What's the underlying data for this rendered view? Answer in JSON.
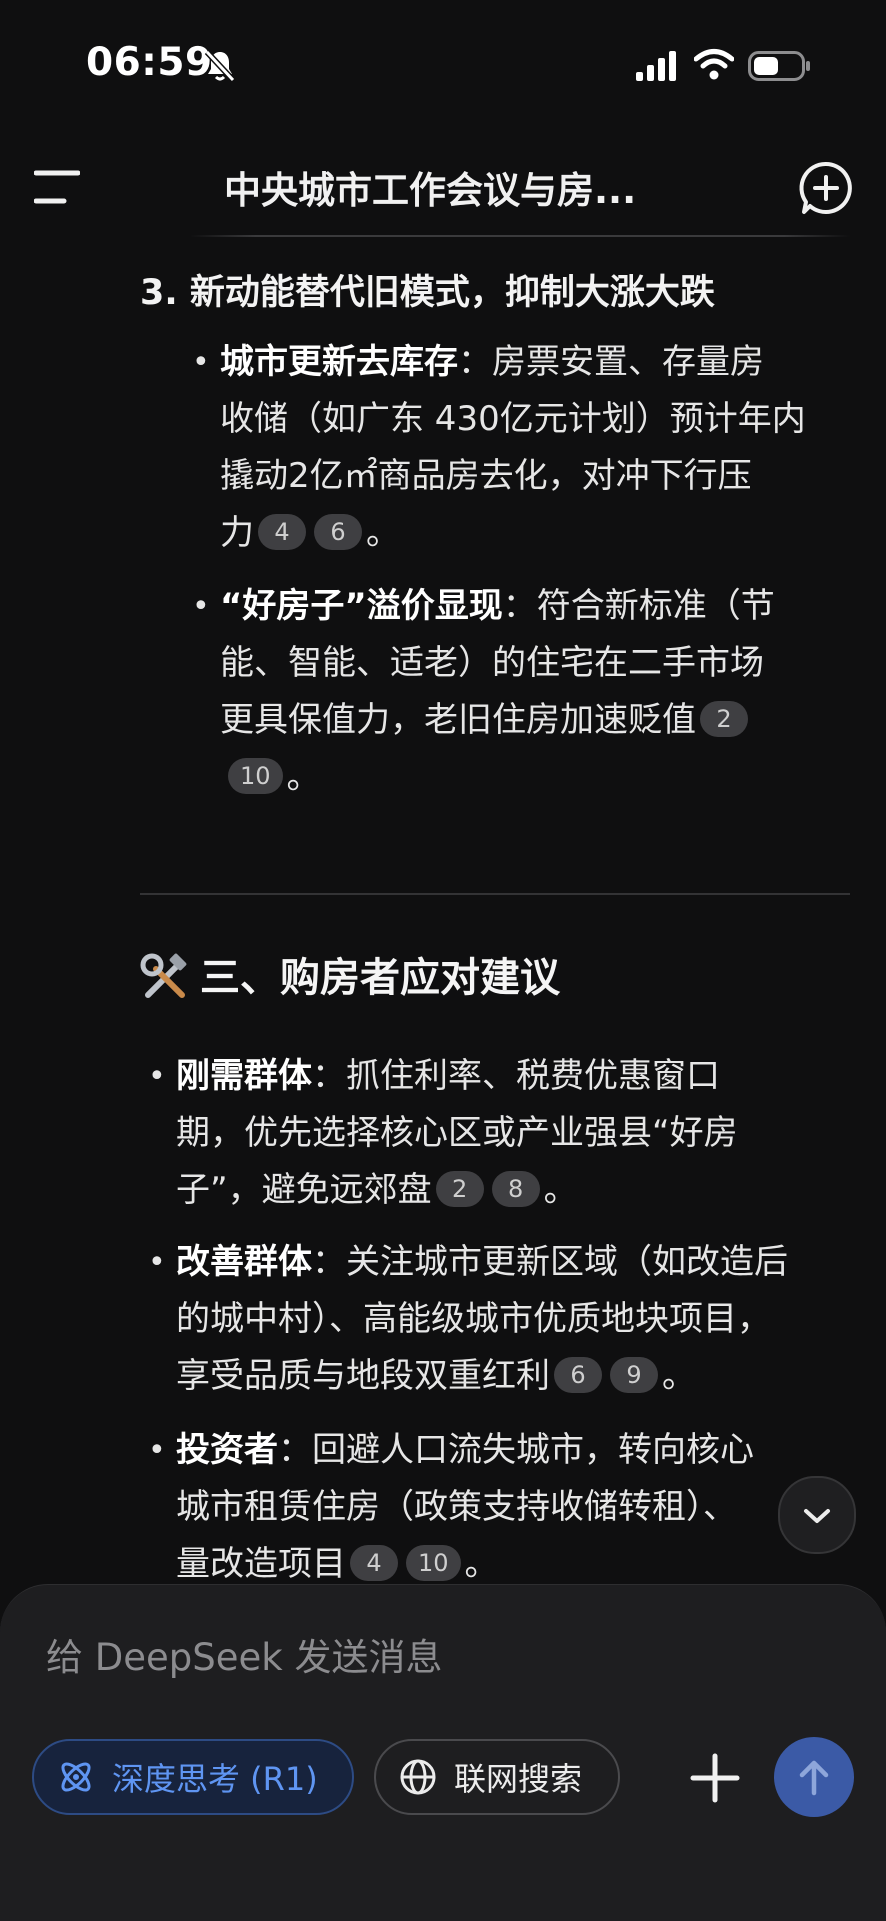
{
  "status_bar": {
    "time": "06:59"
  },
  "header": {
    "title": "中央城市工作会议与房..."
  },
  "section_point3": {
    "heading": "3. 新动能替代旧模式，抑制大涨大跌",
    "bullets": [
      {
        "bold": "城市更新去库存",
        "line1": "：房票安置、存量房",
        "line2": "收储（如广东 430亿元计划）预计年内",
        "line3": "撬动2亿㎡商品房去化，对冲下行压",
        "line4": "力",
        "cites": [
          "4",
          "6"
        ],
        "end": "。"
      },
      {
        "bold": "“好房子”溢价显现",
        "line1": "：符合新标准（节",
        "line2": "能、智能、适老）的住宅在二手市场",
        "line3": "更具保值力，老旧住房加速贬值",
        "cites": [
          "2",
          "10"
        ],
        "end": "。"
      }
    ]
  },
  "section3": {
    "title": "三、购房者应对建议",
    "icon": "hammer-wrench-icon",
    "bullets": [
      {
        "bold": "刚需群体",
        "line1": "：抓住利率、税费优惠窗口",
        "line2": "期，优先选择核心区或产业强县“好房",
        "line3": "子”，避免远郊盘",
        "cites": [
          "2",
          "8"
        ],
        "end": "。"
      },
      {
        "bold": "改善群体",
        "line1": "：关注城市更新区域（如改造后",
        "line2": "的城中村）、高能级城市优质地块项目，",
        "line3": "享受品质与地段双重红利",
        "cites": [
          "6",
          "9"
        ],
        "end": "。"
      },
      {
        "bold": "投资者",
        "line1": "：回避人口流失城市，转向核心",
        "line2": "城市租赁住房（政策支持收储转租）、",
        "line3": "量改造项目",
        "cites": [
          "4",
          "10"
        ],
        "end": "。"
      }
    ]
  },
  "composer": {
    "placeholder": "给 DeepSeek 发送消息",
    "deep_think_label": "深度思考 (R1)",
    "web_search_label": "联网搜索"
  },
  "colors": {
    "background": "#0f0f10",
    "accent_blue": "#5f95f2",
    "send_button": "#3b5aa6"
  }
}
